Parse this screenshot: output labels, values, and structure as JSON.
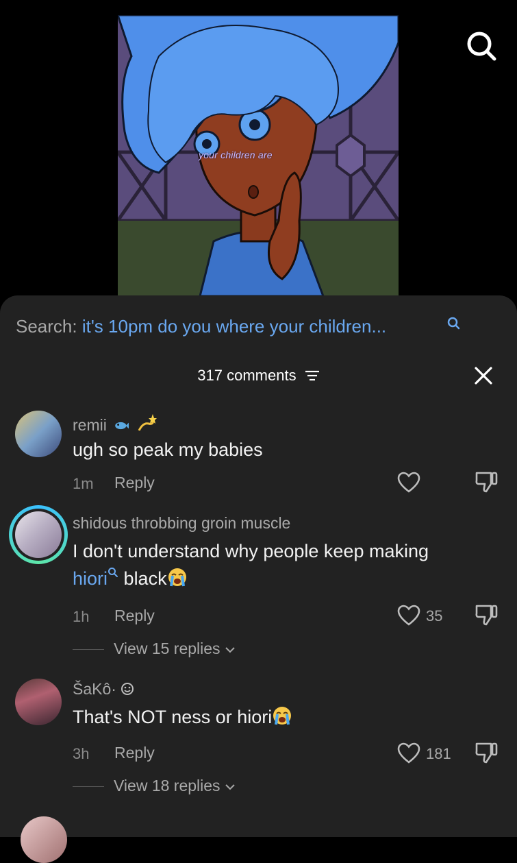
{
  "video": {
    "overlay_caption": "your children are"
  },
  "search": {
    "label": "Search:",
    "query": "it's 10pm do you where your children..."
  },
  "comments_header": {
    "count": "317 comments"
  },
  "comments": [
    {
      "username": "remii",
      "text": "ugh so peak my babies",
      "time": "1m",
      "reply": "Reply",
      "likes": ""
    },
    {
      "username": "shidous throbbing groin muscle",
      "text_line1": "I don't understand why people keep making",
      "mention": "hiori",
      "text_line2_rest": "black",
      "time": "1h",
      "reply": "Reply",
      "likes": "35",
      "view_replies": "View 15 replies"
    },
    {
      "username": "ŠaKô·",
      "text": "That's NOT ness or hiori",
      "time": "3h",
      "reply": "Reply",
      "likes": "181",
      "view_replies": "View 18 replies"
    }
  ],
  "colors": {
    "sheet_bg": "#222222",
    "link_blue": "#6aa8f0",
    "muted": "#a9a9a9"
  },
  "icons": [
    "search-icon",
    "filter-icon",
    "close-icon",
    "heart-icon",
    "dislike-icon",
    "crying-emoji",
    "fish-emoji",
    "dizzy-emoji",
    "smiley-emoji",
    "chevron-down-icon"
  ]
}
